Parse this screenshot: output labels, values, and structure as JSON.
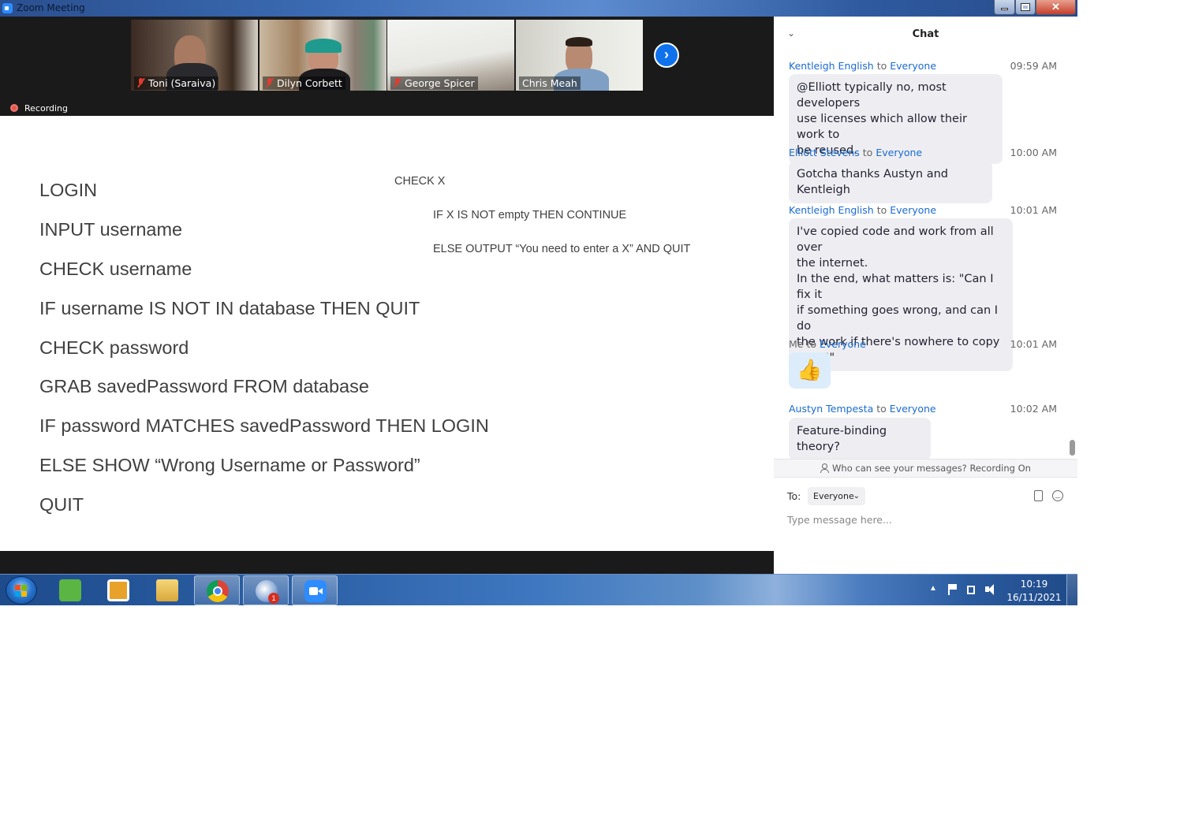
{
  "window": {
    "title": "Zoom Meeting"
  },
  "participants": [
    {
      "name": "Toni (Saraiva)",
      "muted": true
    },
    {
      "name": "Dilyn Corbett",
      "muted": true
    },
    {
      "name": "George Spicer",
      "muted": true
    },
    {
      "name": "Chris Meah",
      "muted": false
    }
  ],
  "recording": {
    "label": "Recording"
  },
  "slide": {
    "left_lines": [
      "LOGIN",
      "INPUT username",
      "CHECK username",
      "IF username IS NOT IN database THEN QUIT",
      "CHECK password",
      "GRAB savedPassword FROM database",
      "IF password MATCHES savedPassword THEN LOGIN",
      "ELSE SHOW “Wrong Username or Password”",
      "QUIT"
    ],
    "right_lines": [
      "CHECK X",
      "IF X IS NOT empty THEN CONTINUE",
      "ELSE OUTPUT “You need to enter a X” AND QUIT"
    ]
  },
  "chat": {
    "title": "Chat",
    "to_word": "to",
    "messages": [
      {
        "sender": "Kentleigh English",
        "recipient": "Everyone",
        "time": "09:59 AM",
        "lines": [
          "@Elliott typically no, most developers",
          "use licenses which allow their work to",
          "be reused."
        ]
      },
      {
        "sender": "Elliott Stevens",
        "recipient": "Everyone",
        "time": "10:00 AM",
        "lines": [
          "Gotcha thanks Austyn and Kentleigh"
        ]
      },
      {
        "sender": "Kentleigh English",
        "recipient": "Everyone",
        "time": "10:01 AM",
        "lines": [
          "I've copied code and work from all over",
          "the internet.",
          "In the end, what matters is: \"Can I fix it",
          "if something goes wrong, and can I do",
          "the work if there's nowhere to copy",
          "from?\""
        ]
      },
      {
        "sender": "Me",
        "recipient": "Everyone",
        "time": "10:01 AM",
        "emoji": "👍"
      },
      {
        "sender": "Austyn Tempesta",
        "recipient": "Everyone",
        "time": "10:02 AM",
        "lines": [
          "Feature-binding theory?"
        ]
      }
    ],
    "privacy_notice": "Who can see your messages? Recording On",
    "to_label": "To:",
    "recipient_selected": "Everyone",
    "input_placeholder": "Type message here..."
  },
  "taskbar": {
    "apps": [
      "evernote",
      "media-player",
      "file-explorer",
      "chrome",
      "thunderbird",
      "zoom"
    ],
    "thunderbird_badge": "1",
    "time": "10:19",
    "date": "16/11/2021"
  }
}
